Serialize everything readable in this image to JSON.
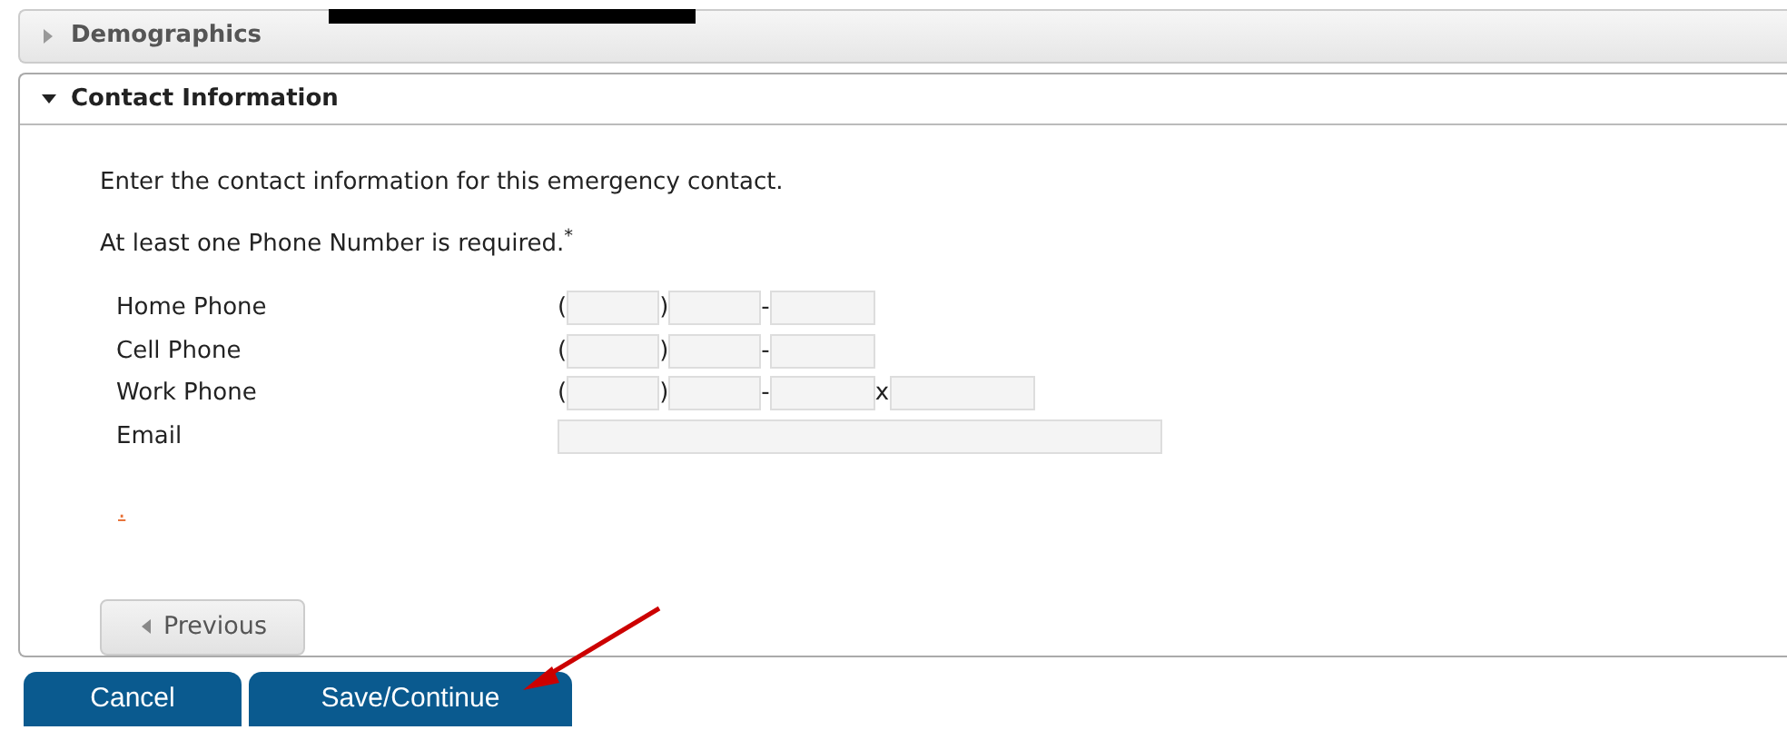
{
  "panels": [
    {
      "title": "Demographics",
      "expanded": false
    },
    {
      "title": "Contact Information",
      "expanded": true
    }
  ],
  "intro": "Enter the contact information for this emergency contact.",
  "requirement": "At least one Phone Number is required.$^{*}$",
  "fields": [
    {
      "label": "Home Phone",
      "kind": "phone",
      "open": "(",
      "close": ")",
      "dash": "-"
    },
    {
      "label": "Cell Phone",
      "kind": "phone",
      "open": "(",
      "close": ")",
      "dash": "-"
    },
    {
      "label": "Work Phone",
      "kind": "phone_ext",
      "open": "(",
      "close": ")",
      "dash": "-",
      "ext": "x"
    },
    {
      "label": "Email",
      "kind": "email"
    }
  ],
  "link": ".",
  "previous_button": "Previous",
  "buttons": [
    "Cancel",
    "Save/Continue"
  ]
}
